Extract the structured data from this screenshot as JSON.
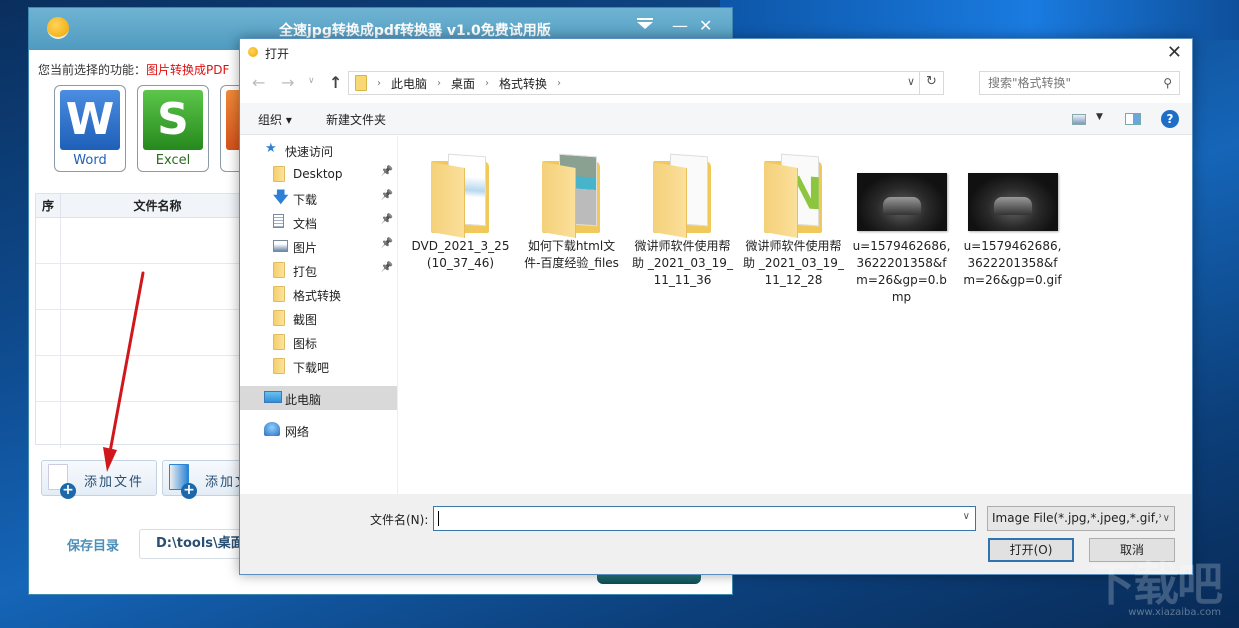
{
  "app": {
    "title": "全速jpg转换成pdf转换器 v1.0免费试用版",
    "function_label": "您当前选择的功能：",
    "function_value": "图片转换成PDF",
    "formats": [
      {
        "label": "Word",
        "letter": "W"
      },
      {
        "label": "Excel",
        "letter": "S"
      },
      {
        "label": "",
        "letter": ""
      }
    ],
    "table": {
      "columns": [
        "序",
        "文件名称"
      ],
      "rows": 5
    },
    "buttons": {
      "add_file": "添加文件",
      "add_folder": "添加文"
    },
    "save_dir_label": "保存目录",
    "save_dir_value": "D:\\tools\\桌面"
  },
  "dialog": {
    "title": "打开",
    "breadcrumb": [
      "此电脑",
      "桌面",
      "格式转换"
    ],
    "search_placeholder": "搜索\"格式转换\"",
    "toolbar": {
      "organize": "组织 ▾",
      "new_folder": "新建文件夹"
    },
    "nav_pane": [
      {
        "label": "快速访问",
        "icon": "star",
        "pinned": false,
        "indent": 0
      },
      {
        "label": "Desktop",
        "icon": "folder",
        "pinned": true,
        "indent": 1
      },
      {
        "label": "下载",
        "icon": "download",
        "pinned": true,
        "indent": 1
      },
      {
        "label": "文档",
        "icon": "document",
        "pinned": true,
        "indent": 1
      },
      {
        "label": "图片",
        "icon": "picture",
        "pinned": true,
        "indent": 1
      },
      {
        "label": "打包",
        "icon": "folder",
        "pinned": true,
        "indent": 1
      },
      {
        "label": "格式转换",
        "icon": "folder",
        "pinned": false,
        "indent": 1
      },
      {
        "label": "截图",
        "icon": "folder",
        "pinned": false,
        "indent": 1
      },
      {
        "label": "图标",
        "icon": "folder",
        "pinned": false,
        "indent": 1
      },
      {
        "label": "下载吧",
        "icon": "folder",
        "pinned": false,
        "indent": 1
      },
      {
        "label": "此电脑",
        "icon": "computer",
        "pinned": false,
        "indent": 0,
        "selected": true
      },
      {
        "label": "网络",
        "icon": "network",
        "pinned": false,
        "indent": 0
      }
    ],
    "files": [
      {
        "name": "DVD_2021_3_25 (10_37_46)",
        "type": "folder",
        "preview": "blue"
      },
      {
        "name": "如何下载html文件-百度经验_files",
        "type": "folder",
        "preview": "web"
      },
      {
        "name": "微讲师软件使用帮助 _2021_03_19_11_11_36",
        "type": "folder",
        "preview": "blank"
      },
      {
        "name": "微讲师软件使用帮助 _2021_03_19_11_12_28",
        "type": "folder",
        "preview": "green"
      },
      {
        "name": "u=1579462686,3622201358&fm=26&gp=0.bmp",
        "type": "image",
        "preview": "car"
      },
      {
        "name": "u=1579462686,3622201358&fm=26&gp=0.gif",
        "type": "image",
        "preview": "car"
      }
    ],
    "filename_label": "文件名(N):",
    "filename_value": "",
    "filetype_value": "Image File(*.jpg,*.jpeg,*.gif,*.",
    "open_button": "打开(O)",
    "cancel_button": "取消"
  },
  "watermark": {
    "text": "下载吧",
    "url": "www.xiazaiba.com"
  },
  "colors": {
    "accent_red": "#dd1111",
    "titlebar": "#5aa5c8",
    "dialog_focus": "#2f74b0"
  }
}
